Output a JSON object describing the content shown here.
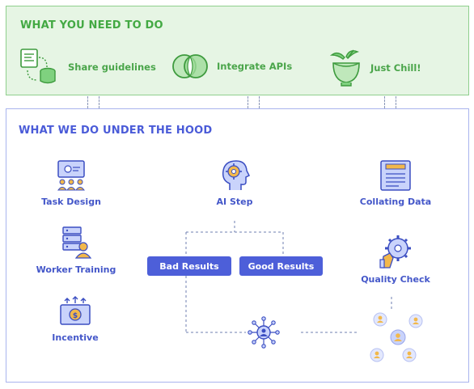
{
  "top": {
    "title": "WHAT YOU NEED TO DO",
    "items": [
      {
        "label": "Share guidelines",
        "icon": "guidelines-icon"
      },
      {
        "label": "Integrate APIs",
        "icon": "integration-icon"
      },
      {
        "label": "Just Chill!",
        "icon": "coconut-drink-icon"
      }
    ]
  },
  "bottom": {
    "title": "WHAT WE DO UNDER THE HOOD",
    "task_design": "Task Design",
    "worker_training": "Worker Training",
    "incentive": "Incentive",
    "ai_step": "AI Step",
    "bad_results": "Bad Results",
    "good_results": "Good Results",
    "collating_data": "Collating Data",
    "quality_check": "Quality Check"
  },
  "colors": {
    "green_accent": "#43a943",
    "green_bg": "#e6f5e4",
    "blue_accent": "#4a5bd8",
    "pill_bg": "#4d5fd9"
  }
}
